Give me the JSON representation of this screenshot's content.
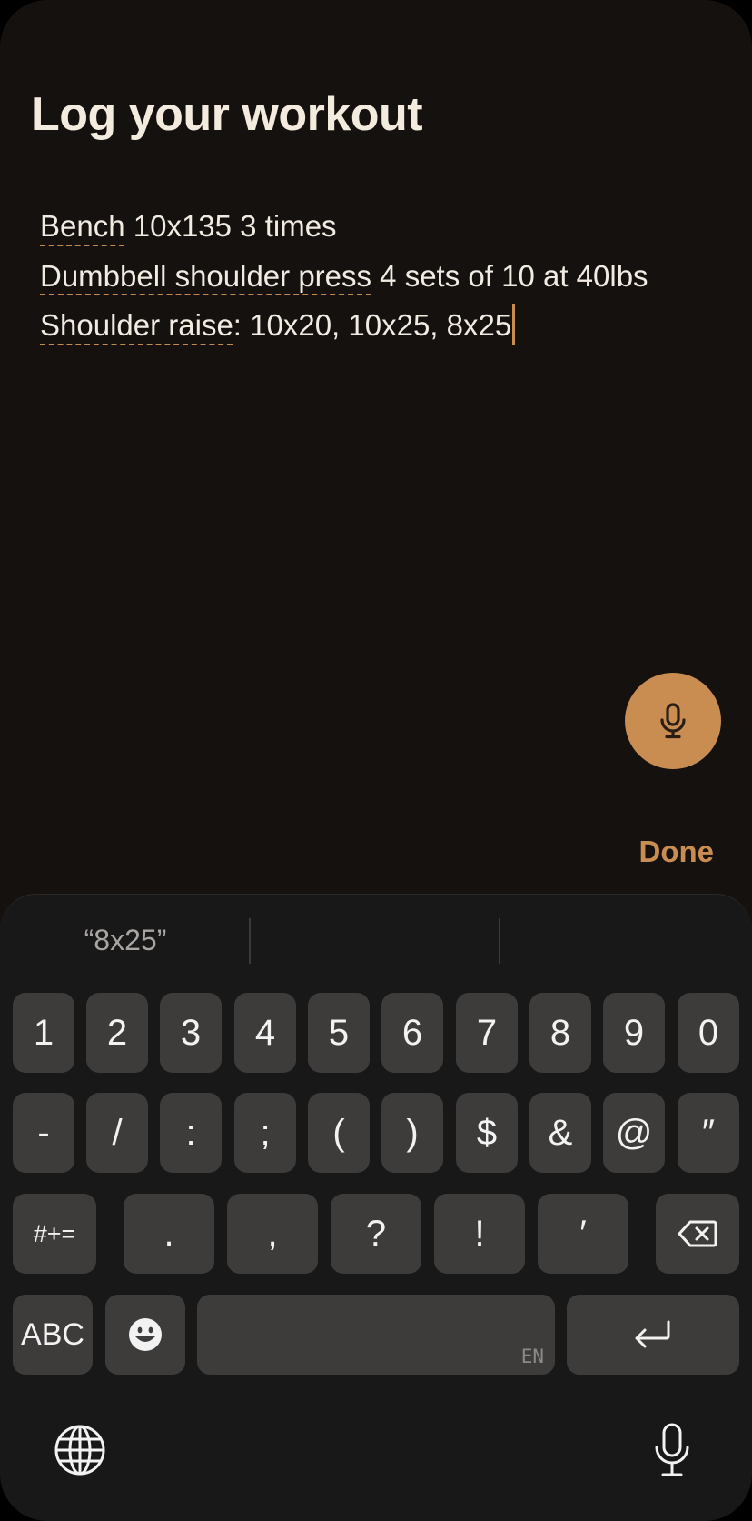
{
  "header": {
    "title": "Log your workout"
  },
  "editor": {
    "lines": [
      {
        "exercise": "Bench",
        "rest": " 10x135 3 times"
      },
      {
        "exercise": "Dumbbell shoulder press",
        "rest": " 4 sets of 10 at 40lbs"
      },
      {
        "exercise": "Shoulder raise",
        "rest": ": 10x20, 10x25, 8x25"
      }
    ]
  },
  "actions": {
    "done_label": "Done",
    "mic_fab_icon": "microphone-icon"
  },
  "keyboard": {
    "suggestions": [
      "“8x25”",
      "",
      ""
    ],
    "row1": [
      "1",
      "2",
      "3",
      "4",
      "5",
      "6",
      "7",
      "8",
      "9",
      "0"
    ],
    "row2": [
      "-",
      "/",
      ":",
      ";",
      "(",
      ")",
      "$",
      "&",
      "@",
      "″"
    ],
    "row3": [
      "#+=",
      ".",
      ",",
      "?",
      "!",
      "′"
    ],
    "row4": {
      "abc": "ABC",
      "space_sub": "EN"
    },
    "icons": [
      "backspace-icon",
      "emoji-icon",
      "return-icon",
      "globe-icon",
      "dictation-mic-icon"
    ]
  },
  "colors": {
    "accent": "#c98d52",
    "background": "#15110f",
    "key": "#3d3c3b",
    "text": "#f1ebe2"
  }
}
